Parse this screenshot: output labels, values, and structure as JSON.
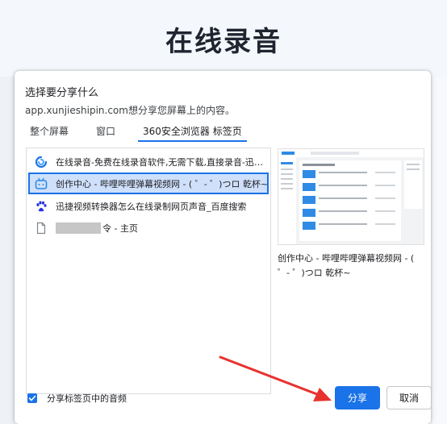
{
  "page": {
    "title": "在线录音"
  },
  "dialog": {
    "title": "选择要分享什么",
    "subtitle": "app.xunjieshipin.com想分享您屏幕上的内容。",
    "tabs": [
      {
        "label": "整个屏幕",
        "active": false
      },
      {
        "label": "窗口",
        "active": false
      },
      {
        "label": "360安全浏览器 标签页",
        "active": true
      }
    ],
    "items": [
      {
        "icon": "xunjie-logo-icon",
        "label": "在线录音-免费在线录音软件,无需下载,直接录音-迅捷..."
      },
      {
        "icon": "bilibili-icon",
        "label": "创作中心 - 哔哩哔哩弹幕视频网 - ( ゜- ゜)つロ 乾杯~",
        "selected": true
      },
      {
        "icon": "baidu-paw-icon",
        "label": "迅捷视频转换器怎么在线录制网页声音_百度搜索"
      },
      {
        "icon": "page-icon",
        "label": "令 - 主页"
      }
    ],
    "preview_caption": "创作中心 - 哔哩哔哩弹幕视频网 - ( ゜- ゜)つロ 乾杯~",
    "audio_checkbox": {
      "label": "分享标签页中的音频",
      "checked": true
    },
    "buttons": {
      "share": "分享",
      "cancel": "取消"
    }
  },
  "colors": {
    "accent": "#1a73e8",
    "selected_bg": "#cfe0fb",
    "annotation_arrow": "#e8322e"
  }
}
